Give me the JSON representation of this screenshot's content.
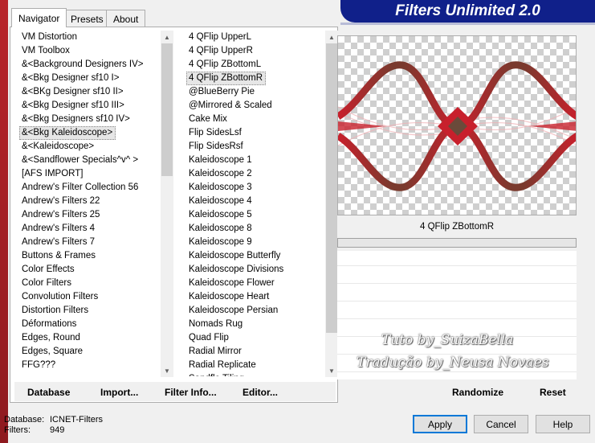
{
  "window": {
    "title": "Filters Unlimited 2.0"
  },
  "tabs": [
    "Navigator",
    "Presets",
    "About"
  ],
  "categories": [
    "VM Distortion",
    "VM Toolbox",
    "&<Background Designers IV>",
    "&<Bkg Designer sf10 I>",
    "&<BKg Designer sf10 II>",
    "&<Bkg Designer sf10 III>",
    "&<Bkg Designers sf10 IV>",
    "&<Bkg Kaleidoscope>",
    "&<Kaleidoscope>",
    "&<Sandflower Specials^v^ >",
    "[AFS IMPORT]",
    "Andrew's Filter Collection 56",
    "Andrew's Filters 22",
    "Andrew's Filters 25",
    "Andrew's Filters 4",
    "Andrew's Filters 7",
    "Buttons & Frames",
    "Color Effects",
    "Color Filters",
    "Convolution Filters",
    "Distortion Filters",
    "Déformations",
    "Edges, Round",
    "Edges, Square",
    "FFG???"
  ],
  "selected_category": "&<Bkg Kaleidoscope>",
  "filters": [
    "4 QFlip UpperL",
    "4 QFlip UpperR",
    "4 QFlip ZBottomL",
    "4 QFlip ZBottomR",
    "@BlueBerry Pie",
    "@Mirrored & Scaled",
    "Cake Mix",
    "Flip SidesLsf",
    "Flip SidesRsf",
    "Kaleidoscope 1",
    "Kaleidoscope 2",
    "Kaleidoscope 3",
    "Kaleidoscope 4",
    "Kaleidoscope 5",
    "Kaleidoscope 8",
    "Kaleidoscope 9",
    "Kaleidoscope Butterfly",
    "Kaleidoscope Divisions",
    "Kaleidoscope Flower",
    "Kaleidoscope Heart",
    "Kaleidoscope Persian",
    "Nomads Rug",
    "Quad Flip",
    "Radial Mirror",
    "Radial Replicate",
    "Sandflo Tiling"
  ],
  "selected_filter": "4 QFlip ZBottomR",
  "buttons": {
    "database": "Database",
    "import": "Import...",
    "filter_info": "Filter Info...",
    "editor": "Editor...",
    "randomize": "Randomize",
    "reset": "Reset",
    "apply": "Apply",
    "cancel": "Cancel",
    "help": "Help"
  },
  "status": {
    "database_label": "Database:",
    "database_value": "ICNET-Filters",
    "filters_label": "Filters:",
    "filters_value": "949"
  },
  "watermark": {
    "line1": "Tuto by_SuizaBella",
    "line2": "Tradução by_Neusa Novaes"
  },
  "colors": {
    "banner": "#10208a",
    "accent_red": "#c8202c",
    "accent_brown": "#7a3a2e",
    "default_button_border": "#0078d7"
  }
}
